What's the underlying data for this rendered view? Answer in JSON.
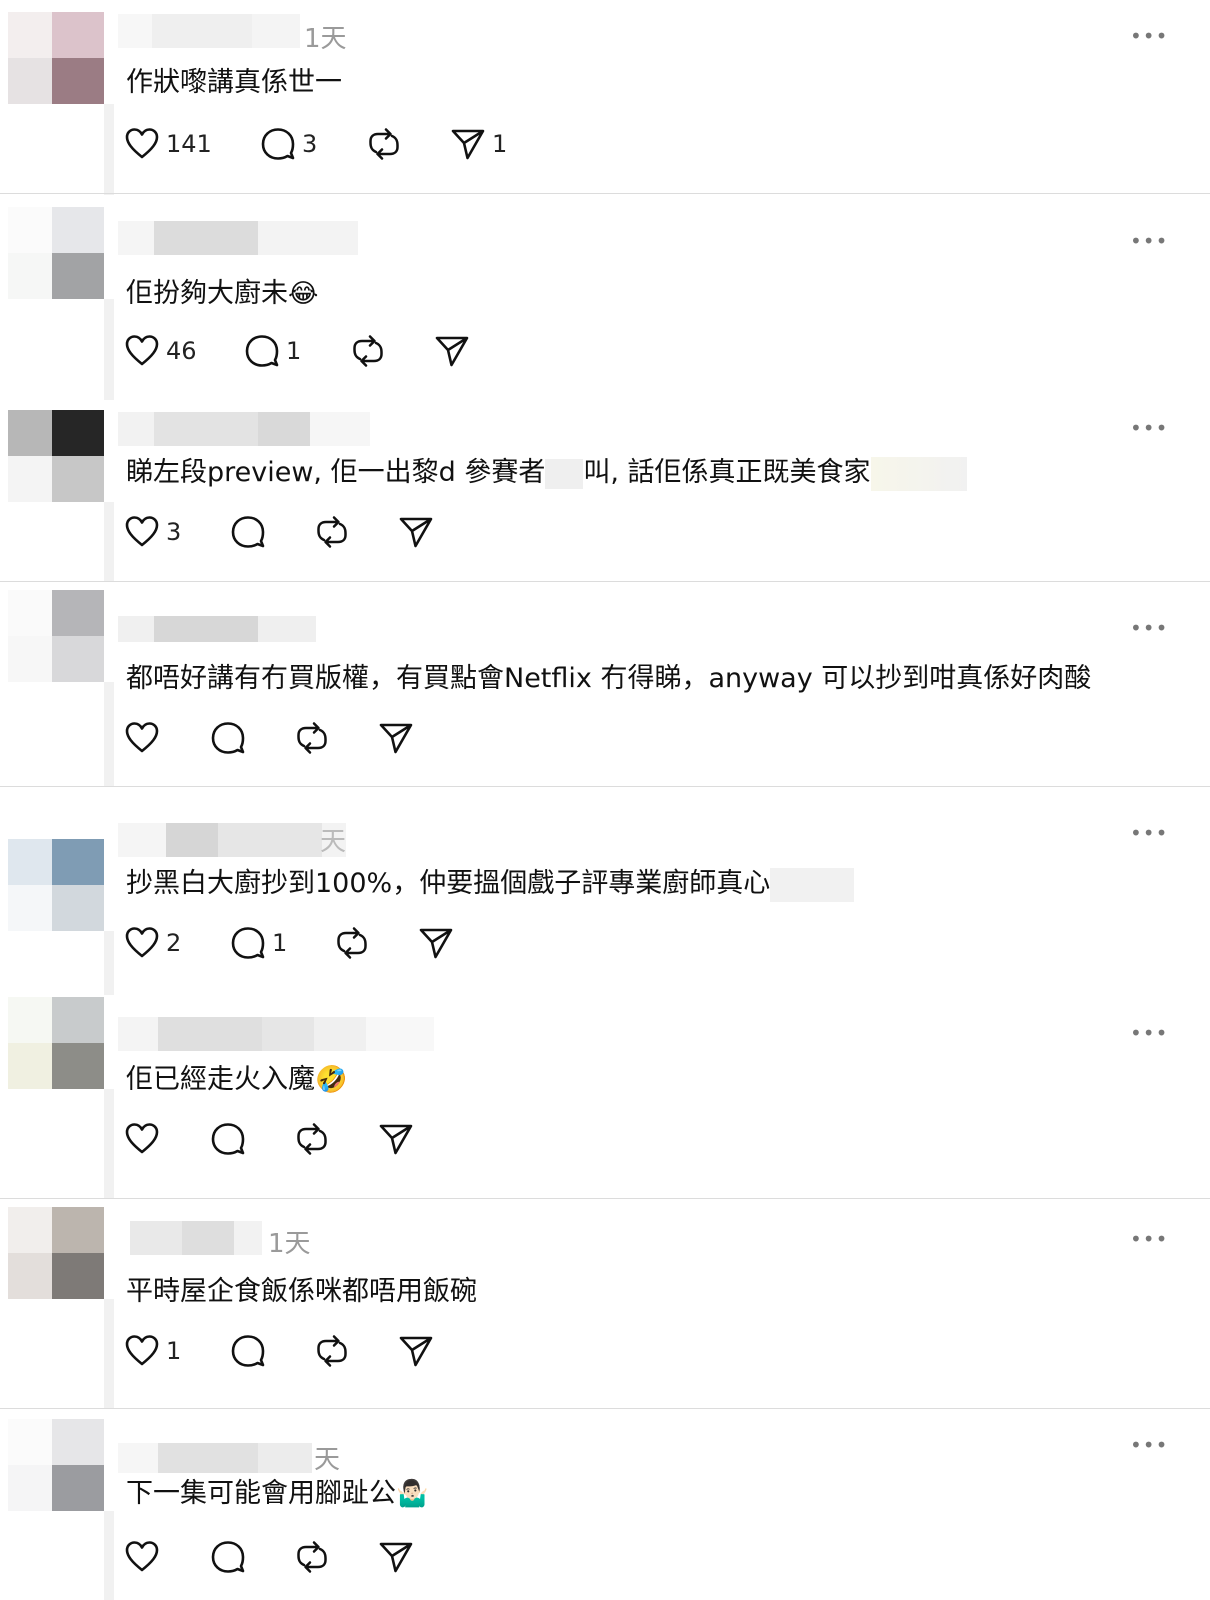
{
  "posts": [
    {
      "time": "1天",
      "text": "作狀嚟講真係世一",
      "emoji": "",
      "likes": "141",
      "replies": "3",
      "reposts": "",
      "shares": "1"
    },
    {
      "time": "",
      "text": "佢扮夠大廚未",
      "emoji": "😂",
      "likes": "46",
      "replies": "1",
      "reposts": "",
      "shares": ""
    },
    {
      "time": "",
      "text": "睇左段preview, 佢一出黎d 參賽者",
      "text2": "叫, 話佢係真正既美食家",
      "emoji": "",
      "likes": "3",
      "replies": "",
      "reposts": "",
      "shares": ""
    },
    {
      "time": "",
      "text": "都唔好講有冇買版權，有買點會Netflix 冇得睇，anyway 可以抄到咁真係好肉酸",
      "emoji": "",
      "likes": "",
      "replies": "",
      "reposts": "",
      "shares": ""
    },
    {
      "time": "天",
      "text": "抄黑白大廚抄到100%，仲要搵個戲子評專業廚師真心",
      "emoji": "",
      "likes": "2",
      "replies": "1",
      "reposts": "",
      "shares": ""
    },
    {
      "time": "",
      "text": "佢已經走火入魔",
      "emoji": "🤣",
      "likes": "",
      "replies": "",
      "reposts": "",
      "shares": ""
    },
    {
      "time": "1天",
      "text": "平時屋企食飯係咪都唔用飯碗",
      "emoji": "",
      "likes": "1",
      "replies": "",
      "reposts": "",
      "shares": ""
    },
    {
      "time": "天",
      "text": "下一集可能會用腳趾公",
      "emoji": "🤷🏻‍♂️",
      "likes": "",
      "replies": "",
      "reposts": "",
      "shares": ""
    }
  ],
  "more_label": "•••",
  "icons": {
    "like": "heart-icon",
    "reply": "comment-icon",
    "repost": "repost-icon",
    "share": "send-icon"
  }
}
